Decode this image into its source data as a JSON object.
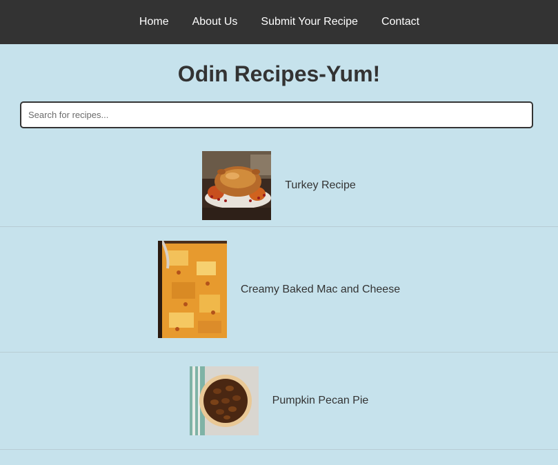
{
  "nav": {
    "items": [
      "Home",
      "About Us",
      "Submit Your Recipe",
      "Contact"
    ]
  },
  "header": {
    "title": "Odin Recipes-Yum!"
  },
  "search": {
    "placeholder": "Search for recipes..."
  },
  "recipes": [
    {
      "name": "Turkey Recipe",
      "image": "roast-turkey-photo"
    },
    {
      "name": "Creamy Baked Mac and Cheese",
      "image": "mac-and-cheese-photo"
    },
    {
      "name": "Pumpkin Pecan Pie",
      "image": "pecan-pie-photo"
    }
  ],
  "colors": {
    "nav_bg": "#333333",
    "page_bg": "#c6e2ec",
    "text": "#333333"
  }
}
